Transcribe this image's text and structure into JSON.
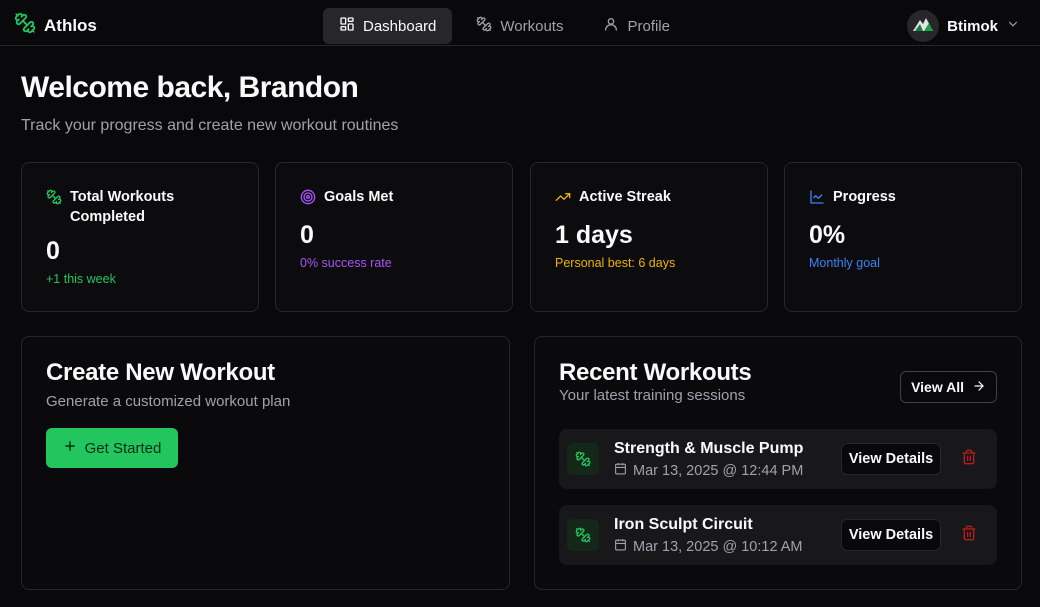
{
  "app": {
    "name": "Athlos"
  },
  "nav": {
    "items": [
      {
        "label": "Dashboard",
        "icon": "dashboard-icon",
        "active": true
      },
      {
        "label": "Workouts",
        "icon": "dumbbell-icon",
        "active": false
      },
      {
        "label": "Profile",
        "icon": "user-icon",
        "active": false
      }
    ]
  },
  "user": {
    "name": "Btimok"
  },
  "welcome": {
    "title": "Welcome back, Brandon",
    "subtitle": "Track your progress and create new workout routines"
  },
  "stats": [
    {
      "label": "Total Workouts Completed",
      "value": "0",
      "note": "+1 this week",
      "icon": "dumbbell-icon",
      "color": "#22c55e"
    },
    {
      "label": "Goals Met",
      "value": "0",
      "note": "0% success rate",
      "icon": "target-icon",
      "color": "#a855f7"
    },
    {
      "label": "Active Streak",
      "value": "1 days",
      "note": "Personal best: 6 days",
      "icon": "trending-up-icon",
      "color": "#eab308"
    },
    {
      "label": "Progress",
      "value": "0%",
      "note": "Monthly goal",
      "icon": "line-chart-icon",
      "color": "#3b82f6"
    }
  ],
  "create": {
    "title": "Create New Workout",
    "subtitle": "Generate a customized workout plan",
    "button": "Get Started"
  },
  "recent": {
    "title": "Recent Workouts",
    "subtitle": "Your latest training sessions",
    "view_all": "View All",
    "details_label": "View Details",
    "items": [
      {
        "name": "Strength & Muscle Pump",
        "date": "Mar 13, 2025 @ 12:44 PM"
      },
      {
        "name": "Iron Sculpt Circuit",
        "date": "Mar 13, 2025 @ 10:12 AM"
      }
    ]
  },
  "colors": {
    "accent": "#22c55e",
    "danger": "#dc2626",
    "background": "#09090b"
  }
}
